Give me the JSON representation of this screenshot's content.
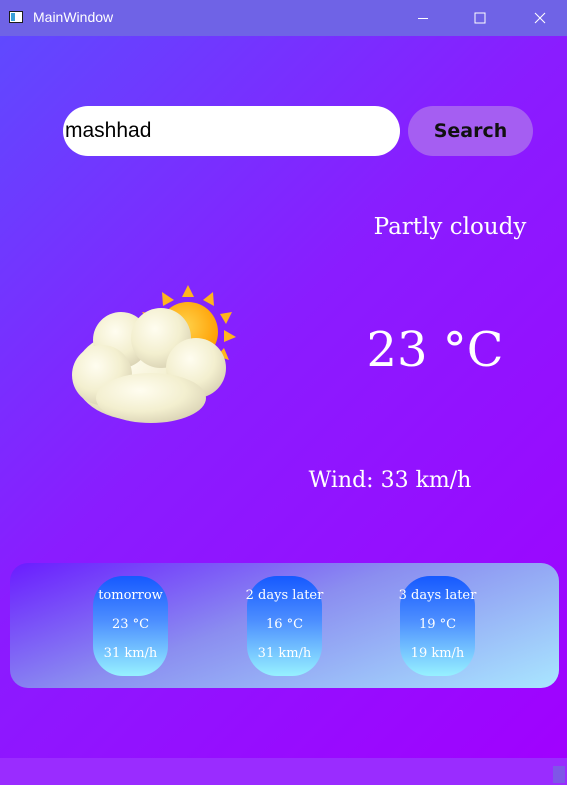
{
  "window": {
    "title": "MainWindow",
    "icons": {
      "app": "app-window-icon",
      "minimize": "minimize-icon",
      "maximize": "maximize-icon",
      "close": "close-icon"
    }
  },
  "search": {
    "value": "mashhad",
    "button_label": "Search"
  },
  "current": {
    "condition": "Partly cloudy",
    "temperature": "23 °C",
    "wind": "Wind: 33 km/h",
    "icon": "partly-cloudy-icon"
  },
  "forecast": [
    {
      "day": "tomorrow",
      "temp": "23 °C",
      "wind": "31 km/h"
    },
    {
      "day": "2 days later",
      "temp": "16 °C",
      "wind": "31 km/h"
    },
    {
      "day": "3 days later",
      "temp": "19 °C",
      "wind": "19 km/h"
    }
  ],
  "colors": {
    "background_start": "#5d4cff",
    "background_end": "#a100ff",
    "titlebar": "#6f63e6",
    "search_button": "#a55ef2",
    "forecast_card_top": "#1659ff",
    "forecast_card_bottom": "#97f1ff"
  }
}
